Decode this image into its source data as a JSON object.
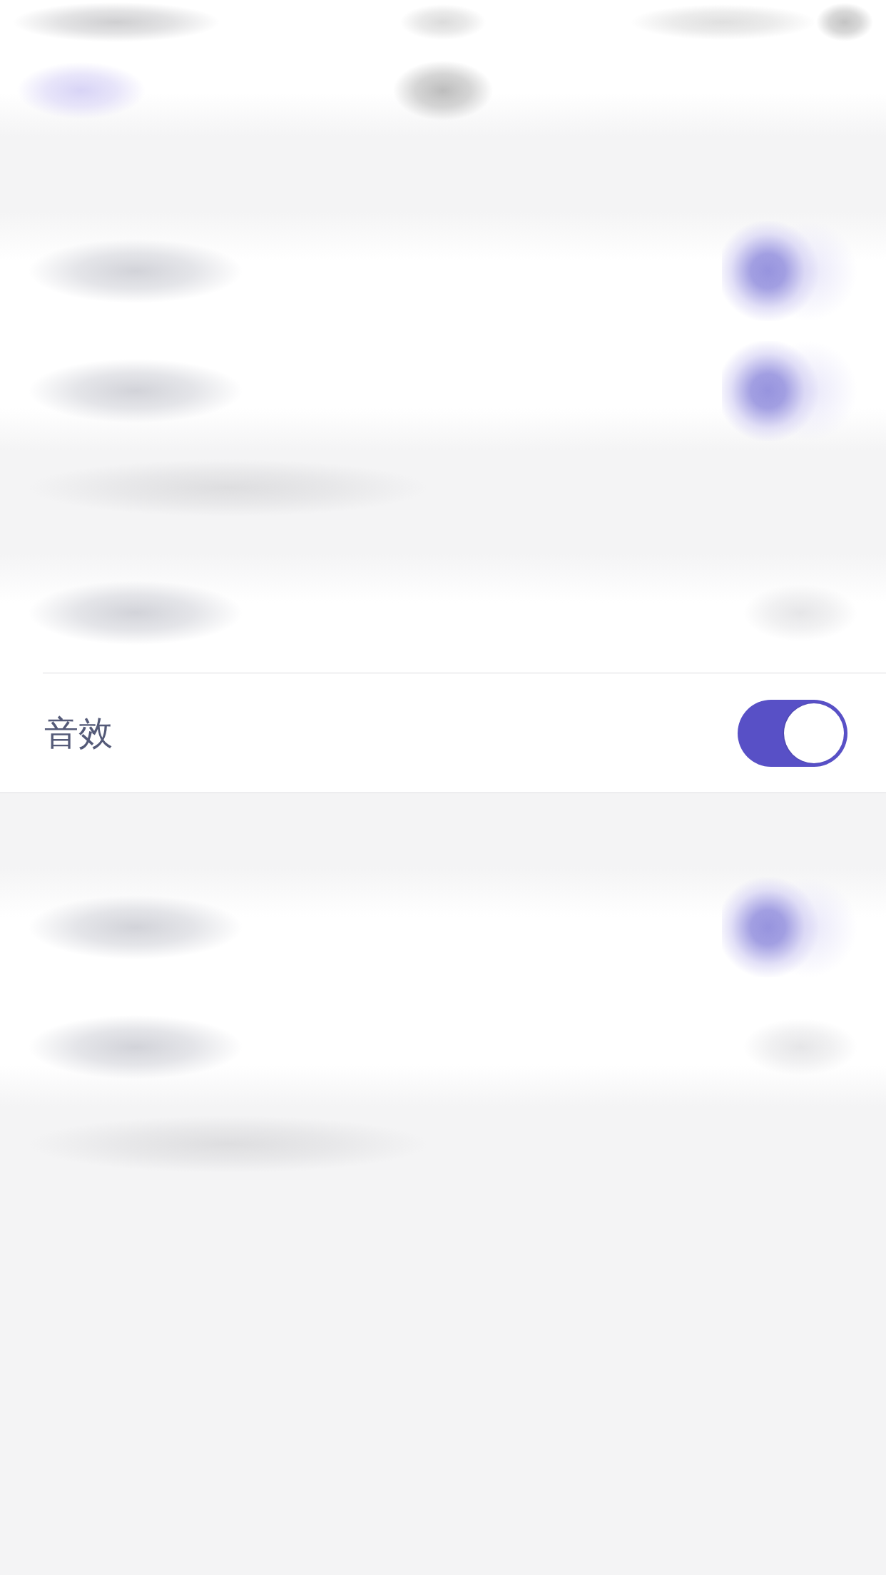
{
  "status_bar": {
    "blurred": true
  },
  "nav_bar": {
    "blurred": true
  },
  "sections": [
    {
      "rows": [
        {
          "kind": "toggle",
          "blurred": true,
          "on": true
        },
        {
          "kind": "toggle",
          "blurred": true,
          "on": true
        }
      ],
      "footnote": {
        "blurred": true
      }
    },
    {
      "rows": [
        {
          "kind": "value",
          "blurred": true
        },
        {
          "kind": "toggle",
          "blurred": false,
          "label": "音效",
          "on": true
        }
      ]
    },
    {
      "rows": [
        {
          "kind": "toggle",
          "blurred": true,
          "on": true
        },
        {
          "kind": "value",
          "blurred": true
        }
      ],
      "footnote": {
        "blurred": true
      }
    }
  ]
}
